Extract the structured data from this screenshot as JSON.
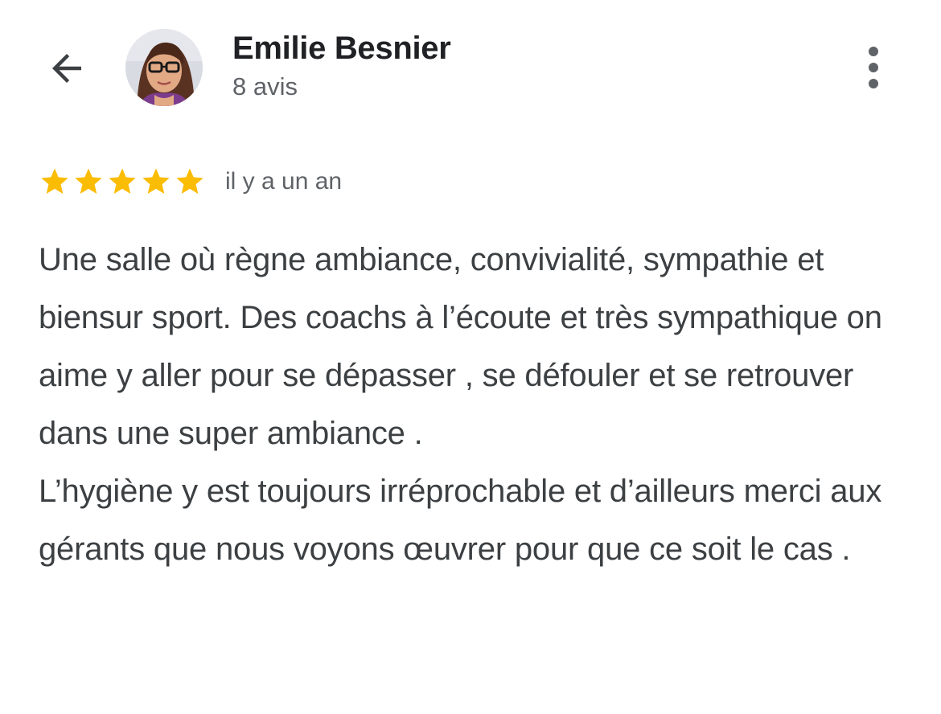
{
  "header": {
    "back_icon": "arrow-left-icon",
    "author_name": "Emilie Besnier",
    "review_count": "8 avis",
    "more_icon": "more-vert-icon"
  },
  "review": {
    "rating": 5,
    "rating_max": 5,
    "star_color": "#fbbc04",
    "date": "il y a un an",
    "paragraphs": [
      "Une salle où règne ambiance, convivialité, sympathie et biensur sport. Des coachs à l’écoute et très sympathique on aime y aller pour se dépasser , se défouler et se retrouver dans une super ambiance .",
      "L’hygiène y est toujours irréprochable et d’ailleurs merci aux gérants que nous voyons œuvrer pour que ce soit le cas ."
    ]
  },
  "colors": {
    "primary_text": "#202124",
    "secondary_text": "#5f6368",
    "body_text": "#3c4043",
    "background": "#ffffff"
  }
}
